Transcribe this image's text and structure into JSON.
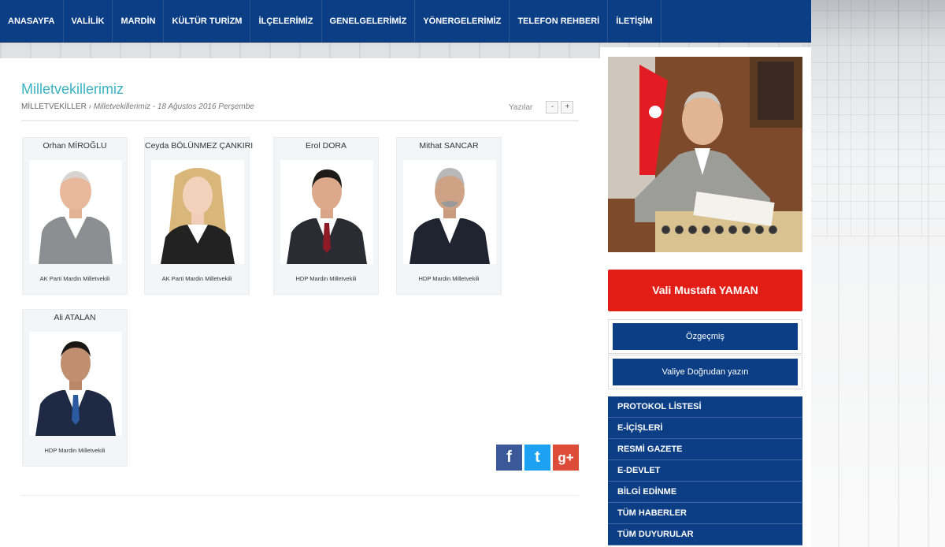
{
  "nav": {
    "items": [
      {
        "label": "ANASAYFA"
      },
      {
        "label": "VALİLİK"
      },
      {
        "label": "MARDİN"
      },
      {
        "label": "KÜLTÜR TURİZM"
      },
      {
        "label": "İLÇELERİMİZ"
      },
      {
        "label": "GENELGELERİMİZ"
      },
      {
        "label": "YÖNERGELERİMİZ"
      },
      {
        "label": "TELEFON REHBERİ"
      },
      {
        "label": "İLETİŞİM"
      }
    ]
  },
  "page": {
    "title": "Milletvekillerimiz",
    "breadcrumb_section": "MİLLETVEKİLLER",
    "breadcrumb_rest": " › Milletvekillerimiz - 18 Ağustos 2016 Perşembe",
    "font_label": "Yazılar",
    "font_minus": "-",
    "font_plus": "+"
  },
  "deputies": [
    {
      "name": "Orhan MİROĞLU",
      "party": "AK Parti Mardin Milletvekili"
    },
    {
      "name": "Ceyda BÖLÜNMEZ ÇANKIRI",
      "party": "AK Parti Mardin Milletvekili"
    },
    {
      "name": "Erol DORA",
      "party": "HDP Mardin Milletvekili"
    },
    {
      "name": "Mithat SANCAR",
      "party": "HDP Mardin Milletvekili"
    },
    {
      "name": "Ali ATALAN",
      "party": "HDP Mardin Milletvekili"
    }
  ],
  "social": {
    "facebook": "f",
    "twitter": "t",
    "googleplus": "g+"
  },
  "sidebar": {
    "governor": "Vali Mustafa YAMAN",
    "cv": "Özgeçmiş",
    "write": "Valiye Doğrudan yazın",
    "links": [
      "PROTOKOL LİSTESİ",
      "E-İÇİŞLERİ",
      "RESMİ GAZETE",
      "E-DEVLET",
      "BİLGİ EDİNME",
      "TÜM HABERLER",
      "TÜM DUYURULAR"
    ]
  },
  "colors": {
    "nav": "#0b3e85",
    "accent_title": "#3bb3c3",
    "governor_btn": "#e11d16"
  }
}
